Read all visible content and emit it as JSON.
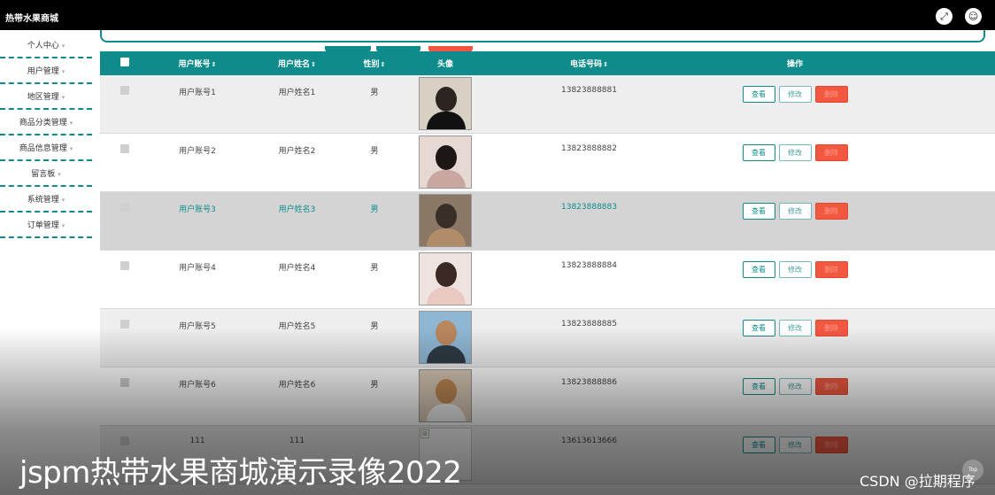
{
  "header": {
    "brand": "热带水果商城"
  },
  "sidebar": {
    "items": [
      {
        "label": "个人中心"
      },
      {
        "label": "用户管理"
      },
      {
        "label": "地区管理"
      },
      {
        "label": "商品分类管理"
      },
      {
        "label": "商品信息管理"
      },
      {
        "label": "留言板"
      },
      {
        "label": "系统管理"
      },
      {
        "label": "订单管理"
      }
    ],
    "arrow": "▾"
  },
  "table": {
    "headers": {
      "account": "用户账号",
      "name": "用户姓名",
      "gender": "性别",
      "avatar": "头像",
      "phone": "电话号码",
      "actions": "操作",
      "sort_icon": "⇕"
    },
    "rows": [
      {
        "account": "用户账号1",
        "name": "用户姓名1",
        "gender": "男",
        "phone": "13823888881"
      },
      {
        "account": "用户账号2",
        "name": "用户姓名2",
        "gender": "男",
        "phone": "13823888882"
      },
      {
        "account": "用户账号3",
        "name": "用户姓名3",
        "gender": "男",
        "phone": "13823888883"
      },
      {
        "account": "用户账号4",
        "name": "用户姓名4",
        "gender": "男",
        "phone": "13823888884"
      },
      {
        "account": "用户账号5",
        "name": "用户姓名5",
        "gender": "男",
        "phone": "13823888885"
      },
      {
        "account": "用户账号6",
        "name": "用户姓名6",
        "gender": "男",
        "phone": "13823888886"
      },
      {
        "account": "111",
        "name": "111",
        "gender": "",
        "phone": "13613613666"
      }
    ],
    "buttons": {
      "view": "查看",
      "edit": "修改",
      "delete": "删除"
    }
  },
  "overlay": {
    "caption": "jspm热带水果商城演示录像2022",
    "watermark": "CSDN @拉期程序",
    "top_button": "Top"
  },
  "colors": {
    "accent": "#0e8b8a",
    "danger": "#f25840",
    "topbar": "#000000"
  }
}
